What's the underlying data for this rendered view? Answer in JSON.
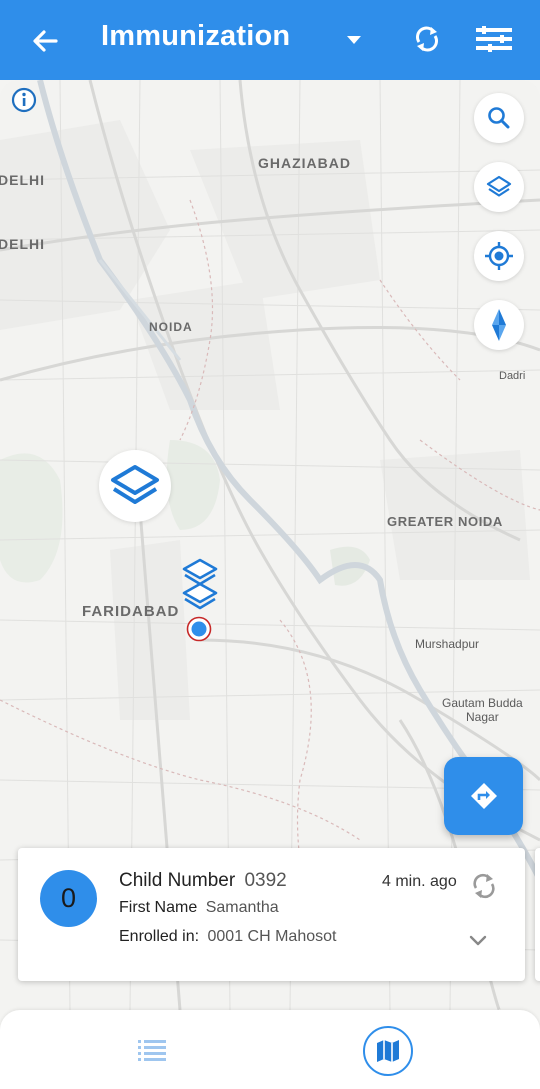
{
  "header": {
    "title": "Immunization",
    "back_icon": "arrow-left-icon",
    "caret_icon": "caret-down-icon",
    "sync_icon": "sync-icon",
    "filter_icon": "filter-list-icon",
    "background": "#2f8eea"
  },
  "map": {
    "labels": {
      "delhi_1": "DELHI",
      "delhi_2": "DELHI",
      "ghaziabad": "GHAZIABAD",
      "noida": "NOIDA",
      "dadri": "Dadri",
      "greater_noida": "GREATER NOIDA",
      "faridabad": "FARIDABAD",
      "murshadpur": "Murshadpur",
      "gautam_1": "Gautam Budda",
      "gautam_2": "Nagar"
    },
    "controls": [
      "search-icon",
      "layers-icon",
      "my-location-icon",
      "compass-icon"
    ],
    "info_icon": "info-icon",
    "directions_icon": "directions-icon"
  },
  "card": {
    "avatar_value": "0",
    "child_number_label": "Child Number",
    "child_number_value": "0392",
    "first_name_label": "First Name",
    "first_name_value": "Samantha",
    "enrolled_label": "Enrolled in:",
    "enrolled_value": "0001 CH Mahosot",
    "time_ago": "4 min. ago"
  },
  "bottom_nav": {
    "items": [
      "list-icon",
      "map-icon"
    ],
    "active": "map-icon"
  },
  "colors": {
    "accent": "#2f8eea",
    "marker_ring": "#c62828"
  }
}
